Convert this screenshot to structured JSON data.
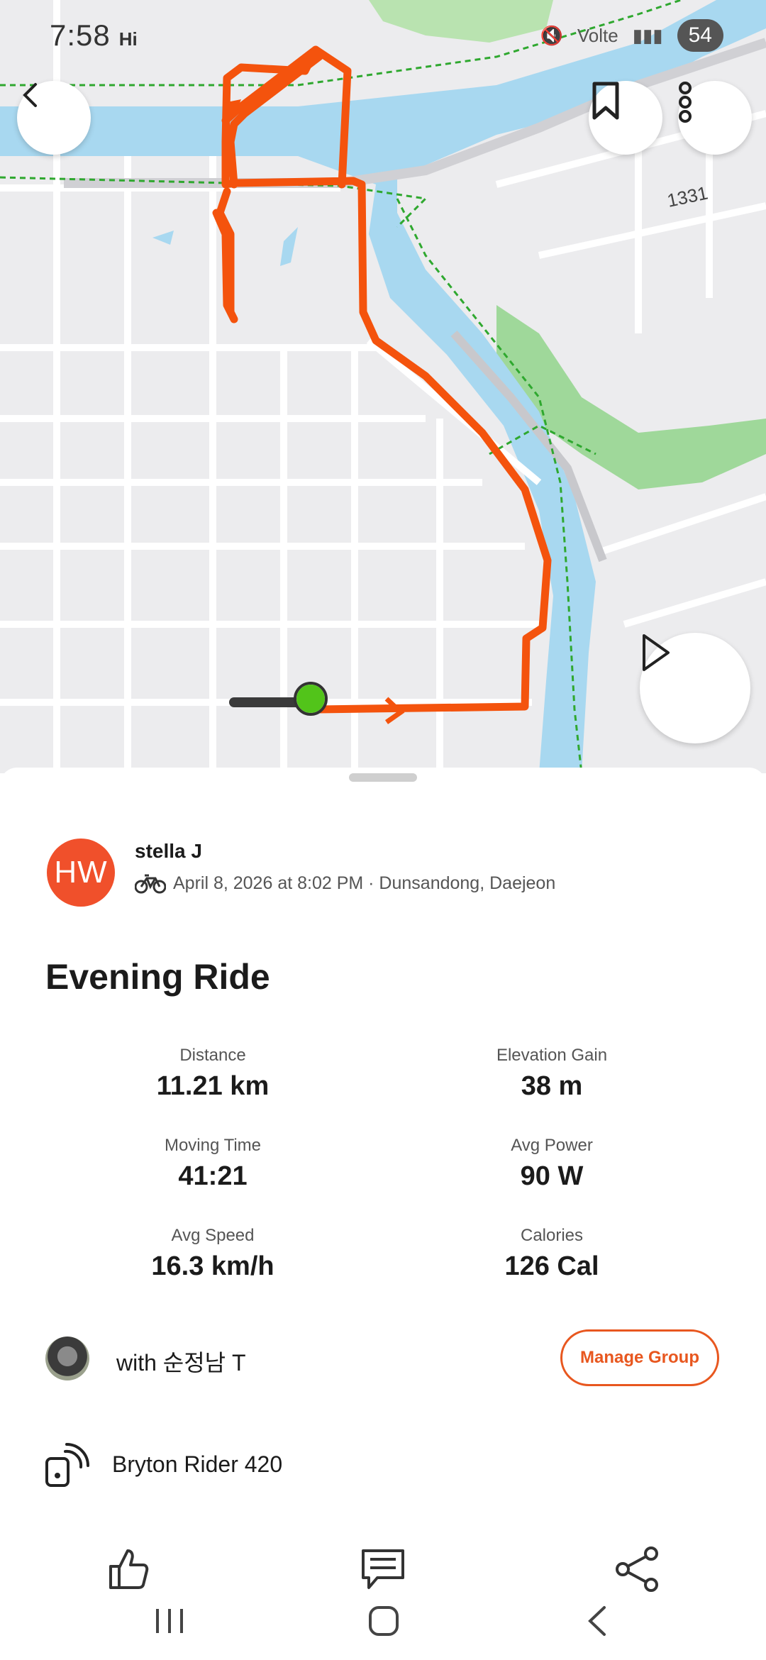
{
  "status_bar": {
    "time": "7:58",
    "indicator": "Hi",
    "network": "Volte",
    "battery": "54"
  },
  "map": {
    "road_label": "1331",
    "route_color": "#f4530d"
  },
  "activity": {
    "avatar_initials": "HW",
    "athlete_name": "stella J",
    "meta": "April 8, 2026 at 8:02 PM · Dunsandong, Daejeon",
    "title": "Evening Ride",
    "stats": [
      {
        "label": "Distance",
        "value": "11.21 km"
      },
      {
        "label": "Elevation Gain",
        "value": "38 m"
      },
      {
        "label": "Moving Time",
        "value": "41:21"
      },
      {
        "label": "Avg Power",
        "value": "90 W"
      },
      {
        "label": "Avg Speed",
        "value": "16.3 km/h"
      },
      {
        "label": "Calories",
        "value": "126 Cal"
      }
    ],
    "group_text": "with 순정남 T",
    "manage_group_label": "Manage Group",
    "device": "Bryton Rider 420"
  },
  "colors": {
    "accent": "#e8571f",
    "avatar_bg": "#f0502b",
    "water": "#a8d8f0",
    "park": "#9fd89a"
  }
}
